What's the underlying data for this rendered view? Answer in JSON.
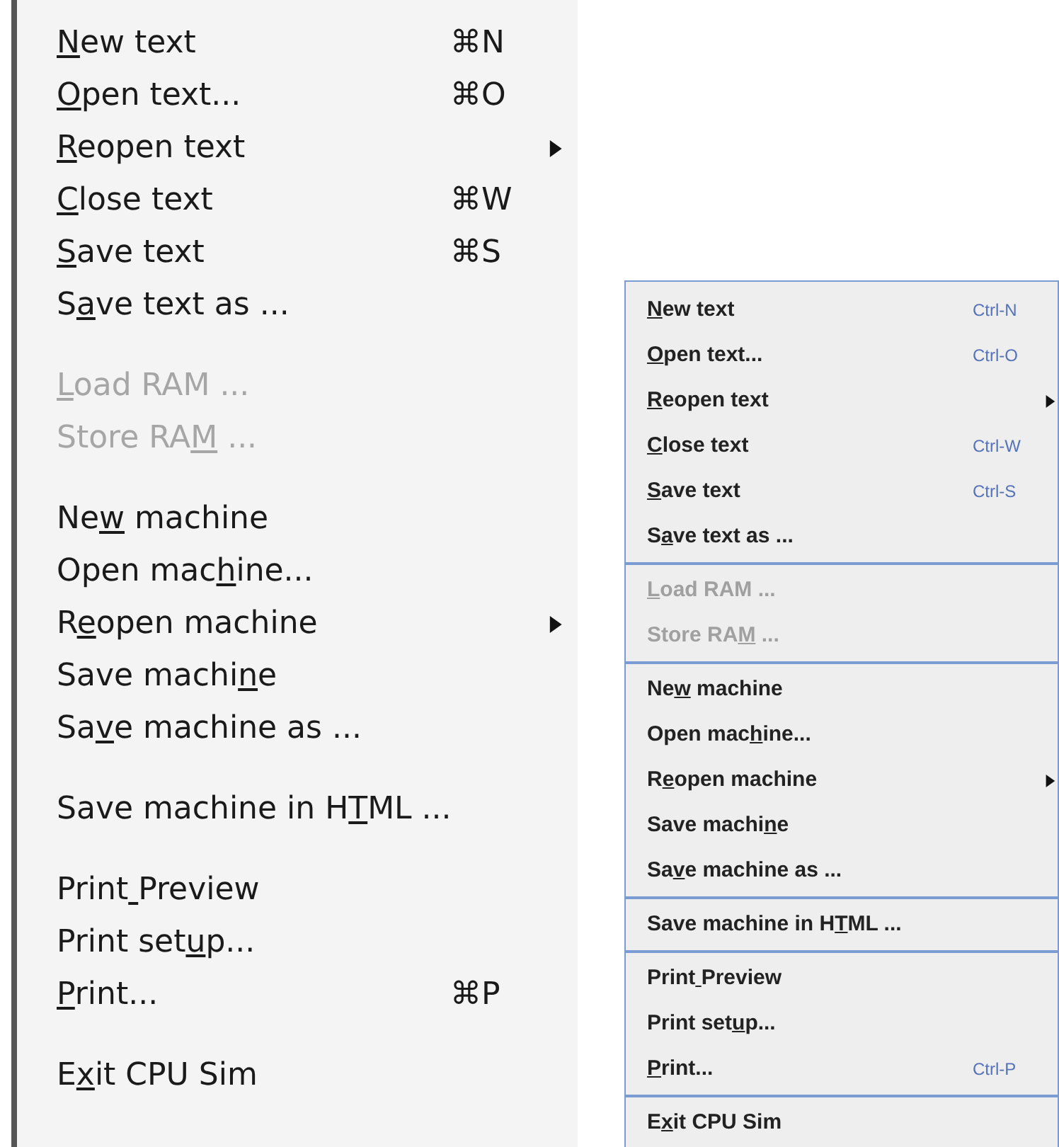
{
  "mac_menu": {
    "sections": [
      [
        {
          "mnemonic": "N",
          "post": "ew text",
          "shortcut": "⌘N",
          "submenu": false,
          "disabled": false
        },
        {
          "mnemonic": "O",
          "post": "pen text...",
          "shortcut": "⌘O",
          "submenu": false,
          "disabled": false
        },
        {
          "mnemonic": "R",
          "post": "eopen text",
          "submenu": true,
          "disabled": false
        },
        {
          "mnemonic": "C",
          "post": "lose text",
          "shortcut": "⌘W",
          "submenu": false,
          "disabled": false
        },
        {
          "mnemonic": "S",
          "post": "ave text",
          "shortcut": "⌘S",
          "submenu": false,
          "disabled": false
        },
        {
          "pre": "S",
          "mnemonic": "a",
          "post": "ve text as ...",
          "submenu": false,
          "disabled": false
        }
      ],
      [
        {
          "mnemonic": "L",
          "post": "oad RAM ...",
          "submenu": false,
          "disabled": true
        },
        {
          "pre": "Store RA",
          "mnemonic": "M",
          "post": " ...",
          "submenu": false,
          "disabled": true
        }
      ],
      [
        {
          "pre": "Ne",
          "mnemonic": "w",
          "post": " machine",
          "submenu": false,
          "disabled": false
        },
        {
          "pre": "Open mac",
          "mnemonic": "h",
          "post": "ine...",
          "submenu": false,
          "disabled": false
        },
        {
          "pre": "R",
          "mnemonic": "e",
          "post": "open machine",
          "submenu": true,
          "disabled": false
        },
        {
          "pre": "Save machi",
          "mnemonic": "n",
          "post": "e",
          "submenu": false,
          "disabled": false
        },
        {
          "pre": "Sa",
          "mnemonic": "v",
          "post": "e machine as ...",
          "submenu": false,
          "disabled": false
        }
      ],
      [
        {
          "pre": "Save machine in H",
          "mnemonic": "T",
          "post": "ML ...",
          "submenu": false,
          "disabled": false
        }
      ],
      [
        {
          "pre": "Print",
          "mnemonic_space": true,
          "post": "Preview",
          "submenu": false,
          "disabled": false
        },
        {
          "pre": "Print set",
          "mnemonic": "u",
          "post": "p...",
          "submenu": false,
          "disabled": false
        },
        {
          "mnemonic": "P",
          "post": "rint...",
          "shortcut": "⌘P",
          "submenu": false,
          "disabled": false
        }
      ],
      [
        {
          "pre": "E",
          "mnemonic": "x",
          "post": "it CPU Sim",
          "submenu": false,
          "disabled": false
        }
      ]
    ]
  },
  "java_menu": {
    "sections": [
      [
        {
          "mnemonic": "N",
          "post": "ew text",
          "shortcut": "Ctrl-N",
          "submenu": false,
          "disabled": false
        },
        {
          "mnemonic": "O",
          "post": "pen text...",
          "shortcut": "Ctrl-O",
          "submenu": false,
          "disabled": false
        },
        {
          "mnemonic": "R",
          "post": "eopen text",
          "submenu": true,
          "disabled": false
        },
        {
          "mnemonic": "C",
          "post": "lose text",
          "shortcut": "Ctrl-W",
          "submenu": false,
          "disabled": false
        },
        {
          "mnemonic": "S",
          "post": "ave text",
          "shortcut": "Ctrl-S",
          "submenu": false,
          "disabled": false
        },
        {
          "pre": "S",
          "mnemonic": "a",
          "post": "ve text as ...",
          "submenu": false,
          "disabled": false
        }
      ],
      [
        {
          "mnemonic": "L",
          "post": "oad RAM ...",
          "submenu": false,
          "disabled": true
        },
        {
          "pre": "Store RA",
          "mnemonic": "M",
          "post": " ...",
          "submenu": false,
          "disabled": true
        }
      ],
      [
        {
          "pre": "Ne",
          "mnemonic": "w",
          "post": " machine",
          "submenu": false,
          "disabled": false
        },
        {
          "pre": "Open mac",
          "mnemonic": "h",
          "post": "ine...",
          "submenu": false,
          "disabled": false
        },
        {
          "pre": "R",
          "mnemonic": "e",
          "post": "open machine",
          "submenu": true,
          "disabled": false
        },
        {
          "pre": "Save machi",
          "mnemonic": "n",
          "post": "e",
          "submenu": false,
          "disabled": false
        },
        {
          "pre": "Sa",
          "mnemonic": "v",
          "post": "e machine as ...",
          "submenu": false,
          "disabled": false
        }
      ],
      [
        {
          "pre": "Save machine in H",
          "mnemonic": "T",
          "post": "ML ...",
          "submenu": false,
          "disabled": false
        }
      ],
      [
        {
          "pre": "Print",
          "mnemonic_space": true,
          "post": "Preview",
          "submenu": false,
          "disabled": false
        },
        {
          "pre": "Print set",
          "mnemonic": "u",
          "post": "p...",
          "submenu": false,
          "disabled": false
        },
        {
          "mnemonic": "P",
          "post": "rint...",
          "shortcut": "Ctrl-P",
          "submenu": false,
          "disabled": false
        }
      ],
      [
        {
          "pre": "E",
          "mnemonic": "x",
          "post": "it CPU Sim",
          "submenu": false,
          "disabled": false
        }
      ]
    ]
  }
}
